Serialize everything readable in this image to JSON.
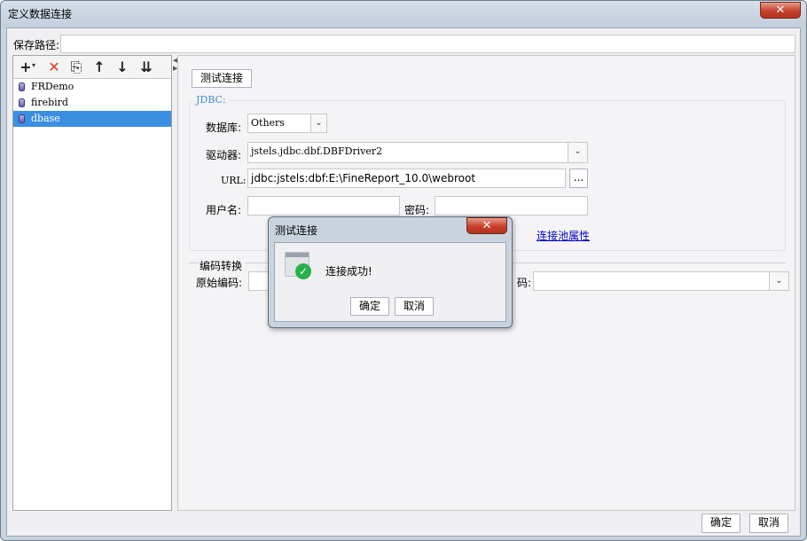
{
  "window": {
    "title": "定义数据连接",
    "close_glyph": "✕"
  },
  "save_path": {
    "label": "保存路径:",
    "value": ""
  },
  "toolbar": {
    "add_icon": "+",
    "delete_icon": "✕",
    "copy_icon": "⎘",
    "up_icon": "↑",
    "down_icon": "↓",
    "sort_icon": "⇊"
  },
  "connections": [
    {
      "name": "FRDemo",
      "selected": false
    },
    {
      "name": "firebird",
      "selected": false
    },
    {
      "name": "dbase",
      "selected": true
    }
  ],
  "right": {
    "test_button": "测试连接",
    "jdbc_title": "JDBC:",
    "database_label": "数据库:",
    "database_value": "Others",
    "driver_label": "驱动器:",
    "driver_value": "jstels.jdbc.dbf.DBFDriver2",
    "url_label": "URL:",
    "url_value": "jdbc:jstels:dbf:E:\\FineReport_10.0\\webroot",
    "url_browse": "...",
    "username_label": "用户名:",
    "username_value": "",
    "password_label": "密码:",
    "password_value": "",
    "pool_link": "连接池属性",
    "encoding_title": "编码转换",
    "orig_encoding_label": "原始编码:",
    "target_encoding_label_partial": "码:"
  },
  "footer": {
    "ok": "确定",
    "cancel": "取消"
  },
  "dialog": {
    "title": "测试连接",
    "message": "连接成功!",
    "ok": "确定",
    "cancel": "取消"
  },
  "colors": {
    "selection": "#3b8fe0",
    "jdbc_title": "#3d8fd6",
    "success": "#27b14a",
    "close_red": "#c6402b"
  }
}
